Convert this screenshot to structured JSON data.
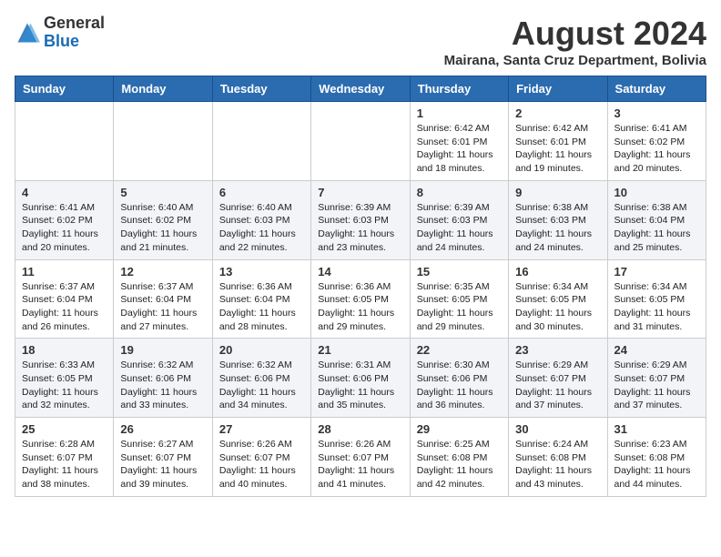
{
  "header": {
    "logo_general": "General",
    "logo_blue": "Blue",
    "month_year": "August 2024",
    "location": "Mairana, Santa Cruz Department, Bolivia"
  },
  "days_of_week": [
    "Sunday",
    "Monday",
    "Tuesday",
    "Wednesday",
    "Thursday",
    "Friday",
    "Saturday"
  ],
  "weeks": [
    [
      {
        "day": "",
        "info": ""
      },
      {
        "day": "",
        "info": ""
      },
      {
        "day": "",
        "info": ""
      },
      {
        "day": "",
        "info": ""
      },
      {
        "day": "1",
        "info": "Sunrise: 6:42 AM\nSunset: 6:01 PM\nDaylight: 11 hours and 18 minutes."
      },
      {
        "day": "2",
        "info": "Sunrise: 6:42 AM\nSunset: 6:01 PM\nDaylight: 11 hours and 19 minutes."
      },
      {
        "day": "3",
        "info": "Sunrise: 6:41 AM\nSunset: 6:02 PM\nDaylight: 11 hours and 20 minutes."
      }
    ],
    [
      {
        "day": "4",
        "info": "Sunrise: 6:41 AM\nSunset: 6:02 PM\nDaylight: 11 hours and 20 minutes."
      },
      {
        "day": "5",
        "info": "Sunrise: 6:40 AM\nSunset: 6:02 PM\nDaylight: 11 hours and 21 minutes."
      },
      {
        "day": "6",
        "info": "Sunrise: 6:40 AM\nSunset: 6:03 PM\nDaylight: 11 hours and 22 minutes."
      },
      {
        "day": "7",
        "info": "Sunrise: 6:39 AM\nSunset: 6:03 PM\nDaylight: 11 hours and 23 minutes."
      },
      {
        "day": "8",
        "info": "Sunrise: 6:39 AM\nSunset: 6:03 PM\nDaylight: 11 hours and 24 minutes."
      },
      {
        "day": "9",
        "info": "Sunrise: 6:38 AM\nSunset: 6:03 PM\nDaylight: 11 hours and 24 minutes."
      },
      {
        "day": "10",
        "info": "Sunrise: 6:38 AM\nSunset: 6:04 PM\nDaylight: 11 hours and 25 minutes."
      }
    ],
    [
      {
        "day": "11",
        "info": "Sunrise: 6:37 AM\nSunset: 6:04 PM\nDaylight: 11 hours and 26 minutes."
      },
      {
        "day": "12",
        "info": "Sunrise: 6:37 AM\nSunset: 6:04 PM\nDaylight: 11 hours and 27 minutes."
      },
      {
        "day": "13",
        "info": "Sunrise: 6:36 AM\nSunset: 6:04 PM\nDaylight: 11 hours and 28 minutes."
      },
      {
        "day": "14",
        "info": "Sunrise: 6:36 AM\nSunset: 6:05 PM\nDaylight: 11 hours and 29 minutes."
      },
      {
        "day": "15",
        "info": "Sunrise: 6:35 AM\nSunset: 6:05 PM\nDaylight: 11 hours and 29 minutes."
      },
      {
        "day": "16",
        "info": "Sunrise: 6:34 AM\nSunset: 6:05 PM\nDaylight: 11 hours and 30 minutes."
      },
      {
        "day": "17",
        "info": "Sunrise: 6:34 AM\nSunset: 6:05 PM\nDaylight: 11 hours and 31 minutes."
      }
    ],
    [
      {
        "day": "18",
        "info": "Sunrise: 6:33 AM\nSunset: 6:05 PM\nDaylight: 11 hours and 32 minutes."
      },
      {
        "day": "19",
        "info": "Sunrise: 6:32 AM\nSunset: 6:06 PM\nDaylight: 11 hours and 33 minutes."
      },
      {
        "day": "20",
        "info": "Sunrise: 6:32 AM\nSunset: 6:06 PM\nDaylight: 11 hours and 34 minutes."
      },
      {
        "day": "21",
        "info": "Sunrise: 6:31 AM\nSunset: 6:06 PM\nDaylight: 11 hours and 35 minutes."
      },
      {
        "day": "22",
        "info": "Sunrise: 6:30 AM\nSunset: 6:06 PM\nDaylight: 11 hours and 36 minutes."
      },
      {
        "day": "23",
        "info": "Sunrise: 6:29 AM\nSunset: 6:07 PM\nDaylight: 11 hours and 37 minutes."
      },
      {
        "day": "24",
        "info": "Sunrise: 6:29 AM\nSunset: 6:07 PM\nDaylight: 11 hours and 37 minutes."
      }
    ],
    [
      {
        "day": "25",
        "info": "Sunrise: 6:28 AM\nSunset: 6:07 PM\nDaylight: 11 hours and 38 minutes."
      },
      {
        "day": "26",
        "info": "Sunrise: 6:27 AM\nSunset: 6:07 PM\nDaylight: 11 hours and 39 minutes."
      },
      {
        "day": "27",
        "info": "Sunrise: 6:26 AM\nSunset: 6:07 PM\nDaylight: 11 hours and 40 minutes."
      },
      {
        "day": "28",
        "info": "Sunrise: 6:26 AM\nSunset: 6:07 PM\nDaylight: 11 hours and 41 minutes."
      },
      {
        "day": "29",
        "info": "Sunrise: 6:25 AM\nSunset: 6:08 PM\nDaylight: 11 hours and 42 minutes."
      },
      {
        "day": "30",
        "info": "Sunrise: 6:24 AM\nSunset: 6:08 PM\nDaylight: 11 hours and 43 minutes."
      },
      {
        "day": "31",
        "info": "Sunrise: 6:23 AM\nSunset: 6:08 PM\nDaylight: 11 hours and 44 minutes."
      }
    ]
  ]
}
